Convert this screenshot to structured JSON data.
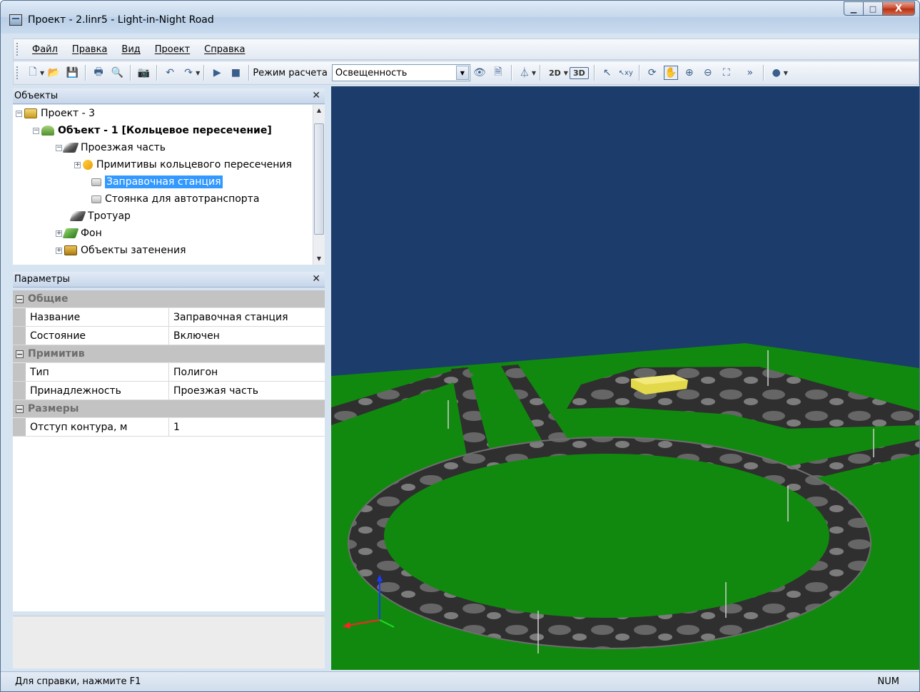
{
  "window": {
    "title": "Проект - 2.linr5 - Light-in-Night Road",
    "buttons": {
      "minimize": "▁",
      "maximize": "□",
      "close": "X"
    }
  },
  "menu": [
    "Файл",
    "Правка",
    "Вид",
    "Проект",
    "Справка"
  ],
  "toolbar": {
    "mode_label": "Режим расчета",
    "mode_value": "Освещенность",
    "btn_2d": "2D",
    "btn_3d": "3D",
    "icons": [
      "new-icon",
      "open-icon",
      "save-icon",
      "print-icon",
      "print-preview-icon",
      "camera-icon",
      "undo-icon",
      "redo-icon",
      "play-icon",
      "stop-icon",
      "eye-icon",
      "document-icon",
      "luminaire-icon",
      "select-icon",
      "select-xy-icon",
      "rotate-icon",
      "pan-hand-icon",
      "zoom-in-icon",
      "zoom-out-icon",
      "zoom-fit-icon",
      "more-icon",
      "help-icon"
    ]
  },
  "objects_panel": {
    "title": "Объекты",
    "close": "✕",
    "items": [
      {
        "label": "Проект - 3",
        "expander": "−"
      },
      {
        "label": "Объект - 1 [Кольцевое пересечение]",
        "expander": "−"
      },
      {
        "label": "Проезжая часть",
        "expander": "−"
      },
      {
        "label": "Примитивы кольцевого пересечения",
        "expander": "+"
      },
      {
        "label": "Заправочная станция"
      },
      {
        "label": "Стоянка для автотранспорта"
      },
      {
        "label": "Тротуар"
      },
      {
        "label": "Фон",
        "expander": "+"
      },
      {
        "label": "Объекты затенения",
        "expander": "+"
      }
    ]
  },
  "params_panel": {
    "title": "Параметры",
    "close": "✕",
    "categories": [
      {
        "name": "Общие",
        "toggle": "−",
        "rows": [
          {
            "name": "Название",
            "value": "Заправочная станция"
          },
          {
            "name": "Состояние",
            "value": "Включен"
          }
        ]
      },
      {
        "name": "Примитив",
        "toggle": "−",
        "rows": [
          {
            "name": "Тип",
            "value": "Полигон"
          },
          {
            "name": "Принадлежность",
            "value": "Проезжая часть"
          }
        ]
      },
      {
        "name": "Размеры",
        "toggle": "−",
        "rows": [
          {
            "name": "Отступ контура, м",
            "value": "1"
          }
        ]
      }
    ]
  },
  "statusbar": {
    "hint": "Для справки, нажмите F1",
    "num": "NUM"
  },
  "colors": {
    "sky": "#1c3c6b",
    "grass": "#11890f",
    "road": "#3a3a3a",
    "selection": "#3399ff",
    "building": "#e3d84a"
  }
}
